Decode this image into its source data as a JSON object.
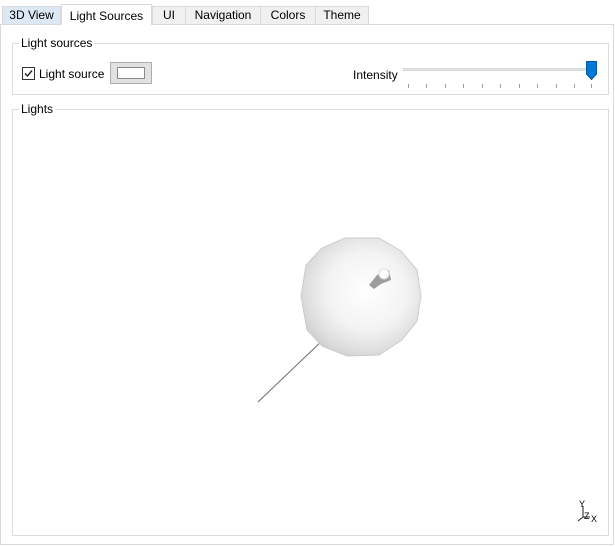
{
  "tabs": [
    {
      "label": "3D View"
    },
    {
      "label": "Light Sources"
    },
    {
      "label": "UI"
    },
    {
      "label": "Navigation"
    },
    {
      "label": "Colors"
    },
    {
      "label": "Theme"
    }
  ],
  "active_tab": "Light Sources",
  "light_sources_group": {
    "title": "Light sources",
    "checkbox_label": "Light source",
    "checkbox_checked": true,
    "color_value": "#ffffff",
    "intensity_label": "Intensity",
    "intensity_value": 1.0
  },
  "lights_group": {
    "title": "Lights",
    "axis_labels": {
      "y": "Y",
      "z": "Z",
      "x": "X"
    }
  },
  "colors": {
    "accent": "#0078d7",
    "first_tab_bg": "#dce8f4"
  },
  "icons": {
    "checkbox_mark": "check-icon",
    "slider_thumb": "slider-thumb-icon",
    "axis_triad": "axis-triad-icon",
    "light_sphere": "light-sphere-icon"
  }
}
